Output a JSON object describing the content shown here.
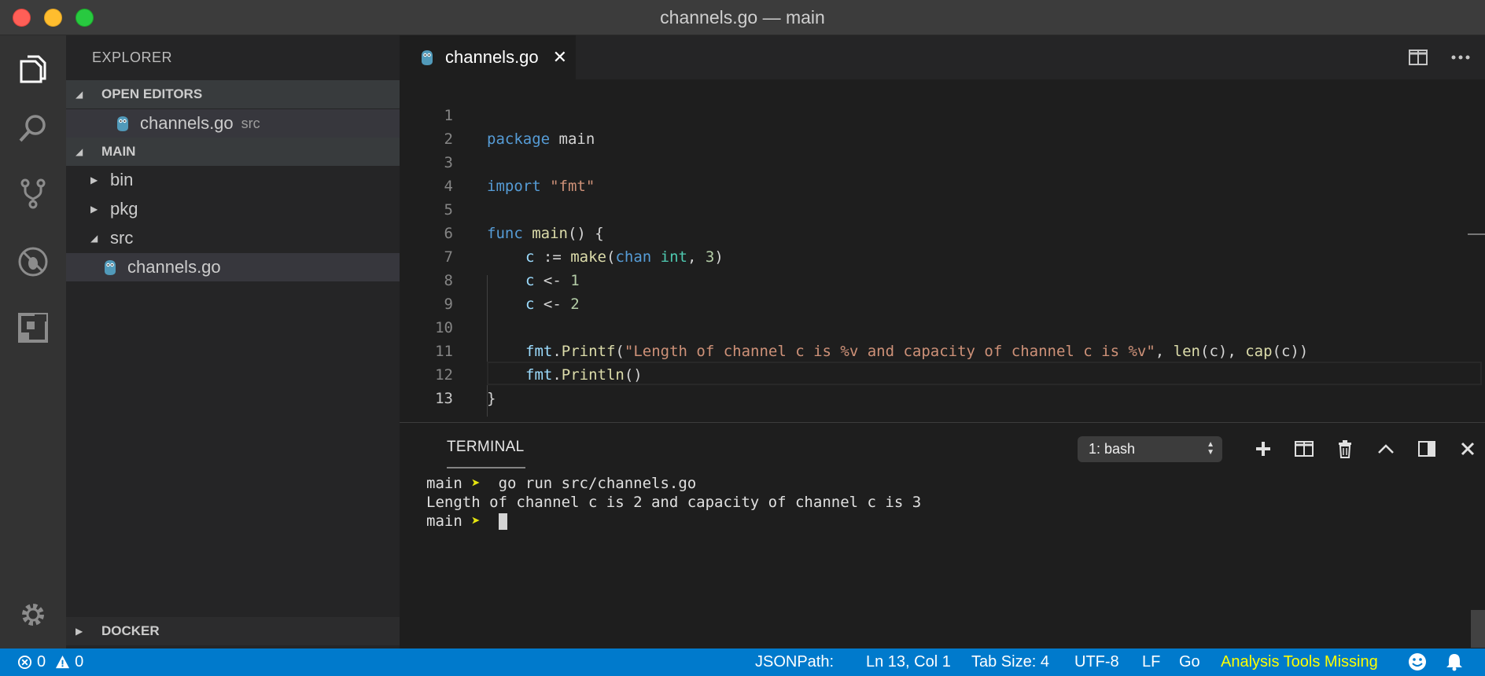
{
  "window": {
    "title": "channels.go — main"
  },
  "sidebar": {
    "title": "EXPLORER",
    "open_editors": {
      "header": "OPEN EDITORS",
      "items": [
        {
          "name": "channels.go",
          "description": "src"
        }
      ]
    },
    "main": {
      "header": "MAIN",
      "items": [
        {
          "name": "bin",
          "type": "folder",
          "expanded": false
        },
        {
          "name": "pkg",
          "type": "folder",
          "expanded": false
        },
        {
          "name": "src",
          "type": "folder",
          "expanded": true
        },
        {
          "name": "channels.go",
          "type": "file",
          "selected": true
        }
      ]
    },
    "docker": {
      "header": "DOCKER"
    }
  },
  "activity_bar": {
    "icons": [
      "files-icon",
      "search-icon",
      "source-control-icon",
      "debug-icon",
      "extensions-icon",
      "gear-icon"
    ]
  },
  "editor": {
    "tab": {
      "label": "channels.go",
      "close": "✕"
    },
    "line_numbers": [
      "1",
      "2",
      "3",
      "4",
      "5",
      "6",
      "7",
      "8",
      "9",
      "10",
      "11",
      "12",
      "13"
    ],
    "code": {
      "l1": [
        "package",
        " main"
      ],
      "l3": [
        "import",
        " ",
        "\"fmt\""
      ],
      "l5": [
        "func",
        " ",
        "main",
        "() {"
      ],
      "l6": [
        "c",
        " := ",
        "make",
        "(",
        "chan",
        " ",
        "int",
        ", ",
        "3",
        ")"
      ],
      "l7": [
        "c",
        " <- ",
        "1"
      ],
      "l8": [
        "c",
        " <- ",
        "2"
      ],
      "l10": [
        "fmt",
        ".",
        "Printf",
        "(",
        "\"Length of channel c is %v and capacity of channel c is %v\"",
        ", ",
        "len",
        "(c), ",
        "cap",
        "(c))"
      ],
      "l11": [
        "fmt",
        ".",
        "Println",
        "()"
      ],
      "l12": [
        "}"
      ]
    }
  },
  "panel": {
    "tab": "TERMINAL",
    "terminal_select": "1: bash",
    "lines": [
      {
        "prompt": "main",
        "arrow": "➤",
        "command": " go run src/channels.go"
      },
      {
        "output": "Length of channel c is 2 and capacity of channel c is 3"
      },
      {
        "prompt": "main",
        "arrow": "➤"
      }
    ]
  },
  "statusbar": {
    "errors": "0",
    "warnings": "0",
    "jsonpath": "JSONPath:",
    "position": "Ln 13, Col 1",
    "tab_size": "Tab Size: 4",
    "encoding": "UTF-8",
    "eol": "LF",
    "language": "Go",
    "analysis": "Analysis Tools Missing"
  },
  "colors": {
    "accent": "#007acc",
    "keyword": "#569cd6",
    "string": "#ce9178",
    "function": "#dcdcaa",
    "number": "#b5cea8",
    "type": "#4ec9b0",
    "warning": "#ffff00"
  }
}
